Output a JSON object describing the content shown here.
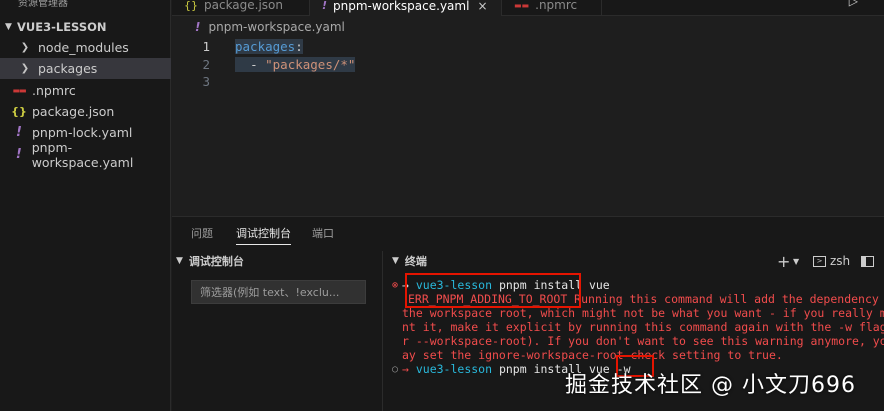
{
  "sidebar": {
    "title": "资源管理器",
    "section": "VUE3-LESSON",
    "items": [
      {
        "label": "node_modules",
        "icon": "chevron-right-icon"
      },
      {
        "label": "packages",
        "icon": "chevron-right-icon"
      },
      {
        "label": ".npmrc",
        "icon": "npm-icon"
      },
      {
        "label": "package.json",
        "icon": "json-icon"
      },
      {
        "label": "pnpm-lock.yaml",
        "icon": "yaml-icon"
      },
      {
        "label": "pnpm-workspace.yaml",
        "icon": "yaml-icon"
      }
    ]
  },
  "tabs": [
    {
      "label": "package.json",
      "icon": "json-icon"
    },
    {
      "label": "pnpm-workspace.yaml",
      "icon": "yaml-icon",
      "active": true
    },
    {
      "label": ".npmrc",
      "icon": "npm-icon"
    }
  ],
  "breadcrumb": {
    "file": "pnpm-workspace.yaml"
  },
  "editor": {
    "lines": [
      {
        "number": "1",
        "key": "packages",
        "punct": ":"
      },
      {
        "number": "2",
        "dash": "- ",
        "value": "\"packages/*\""
      },
      {
        "number": "3"
      }
    ]
  },
  "panel": {
    "tabs": [
      "问题",
      "调试控制台",
      "端口"
    ],
    "debug_header": "调试控制台",
    "filter_placeholder": "筛选器(例如 text、!exclu...",
    "terminal_header": "终端",
    "shell": "zsh",
    "terminal": {
      "line1_dir": "vue3-lesson",
      "line1_cmd": " pnpm install vue",
      "err_code": "ERR_PNPM_ADDING_TO_ROOT",
      "err_rest": " Running this command will add the dependency",
      "wrap1": "the workspace root, which might not be what you want - if you really m",
      "wrap2": "nt it, make it explicit by running this command again with the -w flag",
      "wrap3": "r --workspace-root). If you don't want to see this warning anymore, you",
      "wrap4": "ay set the ignore-workspace-root-check setting to true.",
      "line2_dir": "vue3-lesson",
      "line2_cmd": " pnpm install vue -w"
    }
  },
  "watermark": "掘金技术社区 @ 小文刀696",
  "colors": {
    "accent": "#0078d4",
    "error": "#f14c4c",
    "highlight_box": "#e51400"
  }
}
